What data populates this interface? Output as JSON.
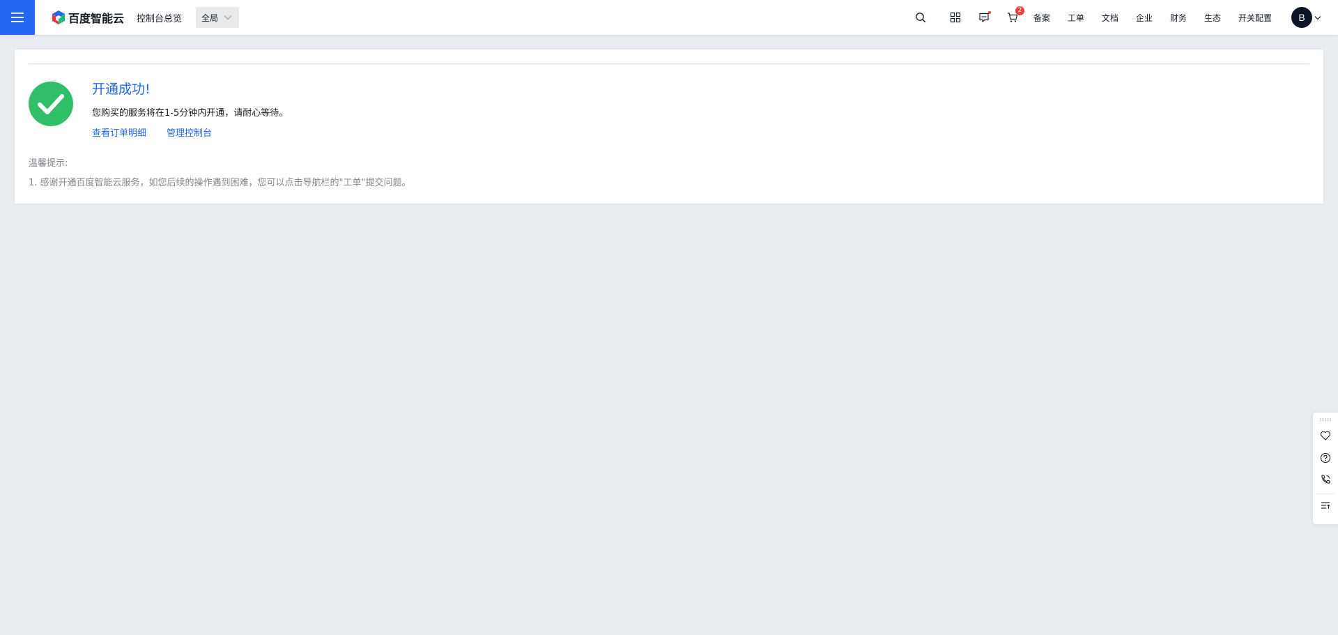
{
  "header": {
    "menu_icon": "hamburger-menu-icon",
    "logo_text": "百度智能云",
    "console_label": "控制台总览",
    "region_value": "全局",
    "icons": {
      "search": "search-icon",
      "apps": "apps-grid-icon",
      "messages": "message-icon",
      "cart": "cart-icon"
    },
    "cart_count": "2",
    "nav": {
      "beian": "备案",
      "ticket": "工单",
      "docs": "文档",
      "enterprise": "企业",
      "finance": "财务",
      "ecosystem": "生态",
      "switch_config": "开关配置"
    },
    "avatar_letter": "B"
  },
  "result": {
    "title": "开通成功!",
    "description": "您购买的服务将在1-5分钟内开通，请耐心等待。",
    "view_order_link": "查看订单明细",
    "manage_console_link": "管理控制台",
    "tips_title": "温馨提示:",
    "tips_item": "1. 感谢开通百度智能云服务，如您后续的操作遇到困难，您可以点击导航栏的\"工单\"提交问题。"
  },
  "side_tools": {
    "drag_icon": "drag-handle-icon",
    "items": [
      "heart-icon",
      "help-icon",
      "phone-icon",
      "list-icon"
    ]
  },
  "colors": {
    "brand_blue": "#2468f2",
    "success_green": "#30bf68",
    "page_bg": "#e8ebf0",
    "badge_red": "#f33e3e",
    "tip_gray": "#84868c"
  }
}
